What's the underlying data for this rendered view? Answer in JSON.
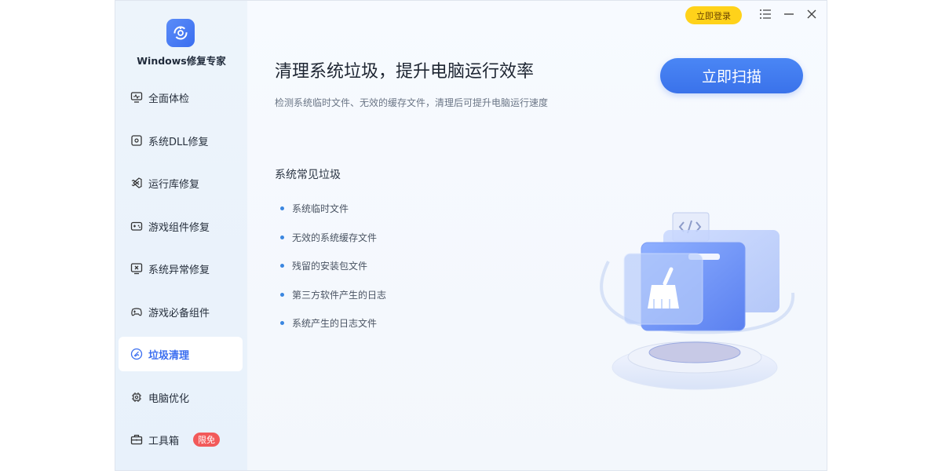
{
  "app": {
    "title": "Windows修复专家"
  },
  "sidebar": {
    "items": [
      {
        "label": "全面体检",
        "icon": "monitor-pulse-icon"
      },
      {
        "label": "系统DLL修复",
        "icon": "dll-icon"
      },
      {
        "label": "运行库修复",
        "icon": "visual-studio-icon"
      },
      {
        "label": "游戏组件修复",
        "icon": "gamepad-icon"
      },
      {
        "label": "系统异常修复",
        "icon": "monitor-x-icon"
      },
      {
        "label": "游戏必备组件",
        "icon": "controller-icon"
      },
      {
        "label": "垃圾清理",
        "icon": "clean-icon",
        "active": true
      },
      {
        "label": "电脑优化",
        "icon": "chip-icon"
      },
      {
        "label": "工具箱",
        "icon": "toolbox-icon",
        "badge": "限免"
      }
    ]
  },
  "header": {
    "login_label": "立即登录"
  },
  "main": {
    "headline": "清理系统垃圾，提升电脑运行效率",
    "subline": "检测系统临时文件、无效的缓存文件，清理后可提升电脑运行速度",
    "scan_label": "立即扫描",
    "section_title": "系统常见垃圾",
    "junk_items": [
      "系统临时文件",
      "无效的系统缓存文件",
      "残留的安装包文件",
      "第三方软件产生的日志",
      "系统产生的日志文件"
    ]
  },
  "colors": {
    "accent": "#3a6ef0",
    "login": "#ffd21a",
    "badge": "#f25a5a"
  }
}
